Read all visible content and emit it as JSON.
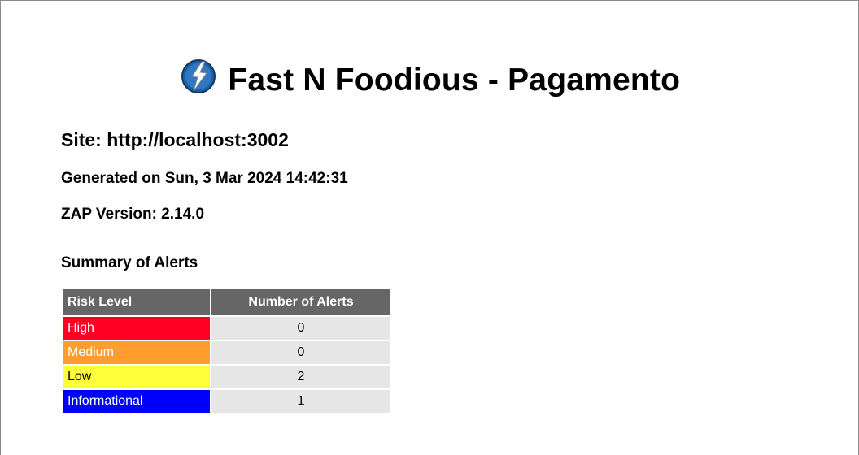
{
  "report": {
    "title": "Fast N Foodious - Pagamento",
    "site": "Site: http://localhost:3002",
    "generated": "Generated on Sun, 3 Mar 2024 14:42:31",
    "version": "ZAP Version: 2.14.0",
    "logo_icon": "zap-lightning-logo-icon"
  },
  "summary": {
    "heading": "Summary of Alerts",
    "columns": [
      "Risk Level",
      "Number of Alerts"
    ],
    "rows": [
      {
        "level": "High",
        "count": "0",
        "bg": "#ff0022",
        "fg": "#ffffff"
      },
      {
        "level": "Medium",
        "count": "0",
        "bg": "#ff9e2e",
        "fg": "#ffffff"
      },
      {
        "level": "Low",
        "count": "2",
        "bg": "#ffff38",
        "fg": "#000000"
      },
      {
        "level": "Informational",
        "count": "1",
        "bg": "#0000ff",
        "fg": "#ffffff"
      }
    ]
  },
  "colors": {
    "header_bg": "#666666",
    "count_bg": "#e6e6e6"
  }
}
